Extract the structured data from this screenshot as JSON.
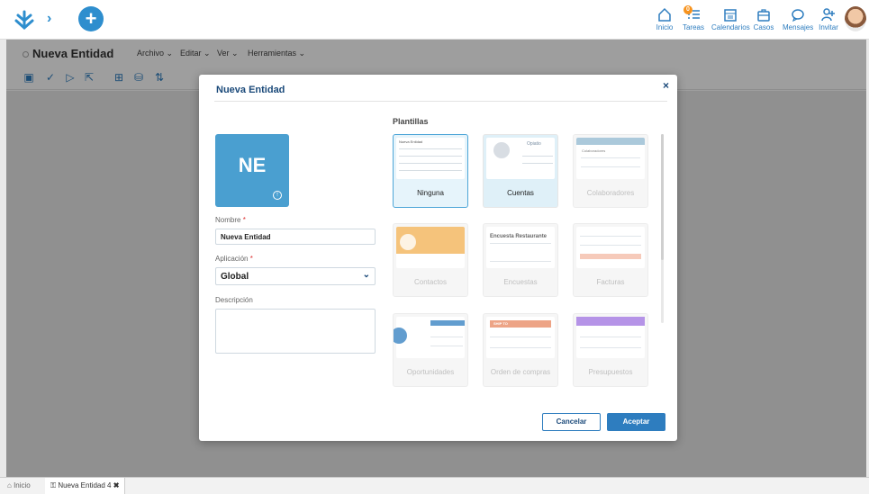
{
  "topbar": {
    "nav": [
      {
        "label": "Inicio",
        "icon": "home-icon"
      },
      {
        "label": "Tareas",
        "icon": "tasks-icon",
        "badge": "0"
      },
      {
        "label": "Calendarios",
        "icon": "calendar-icon"
      },
      {
        "label": "Casos",
        "icon": "briefcase-icon"
      },
      {
        "label": "Mensajes",
        "icon": "chat-icon"
      },
      {
        "label": "Invitar",
        "icon": "add-user-icon"
      }
    ]
  },
  "document": {
    "title": "Nueva Entidad",
    "menus": [
      "Archivo ⌄",
      "Editar ⌄",
      "Ver ⌄",
      "Herramientas ⌄"
    ]
  },
  "statusbar": {
    "home": "Inicio",
    "tab": "Nueva Entidad 4"
  },
  "modal": {
    "title": "Nueva Entidad",
    "close": "×",
    "initials": "NE",
    "name_label": "Nombre",
    "name_value": "Nueva Entidad",
    "app_label": "Aplicación",
    "app_value": "Global",
    "desc_label": "Descripción",
    "templates_label": "Plantillas",
    "templates": [
      {
        "name": "Ninguna",
        "selected": true,
        "thumb_title": "Nueva Entidad"
      },
      {
        "name": "Cuentas",
        "selected": false,
        "thumb_title": "Opiatio"
      },
      {
        "name": "Colaboradores",
        "selected": false,
        "thumb_title": "Colaboradores"
      },
      {
        "name": "Contactos",
        "selected": false,
        "thumb_title": ""
      },
      {
        "name": "Encuestas",
        "selected": false,
        "thumb_title": "Encuesta Restaurante"
      },
      {
        "name": "Facturas",
        "selected": false,
        "thumb_title": ""
      },
      {
        "name": "Oportunidades",
        "selected": false,
        "thumb_title": ""
      },
      {
        "name": "Orden de compras",
        "selected": false,
        "thumb_title": "SHIP TO"
      },
      {
        "name": "Presupuestos",
        "selected": false,
        "thumb_title": ""
      }
    ],
    "cancel_label": "Cancelar",
    "accept_label": "Aceptar"
  },
  "colors": {
    "accent": "#2e7dbf",
    "tile": "#4a9fd0",
    "badge": "#f7931e"
  }
}
